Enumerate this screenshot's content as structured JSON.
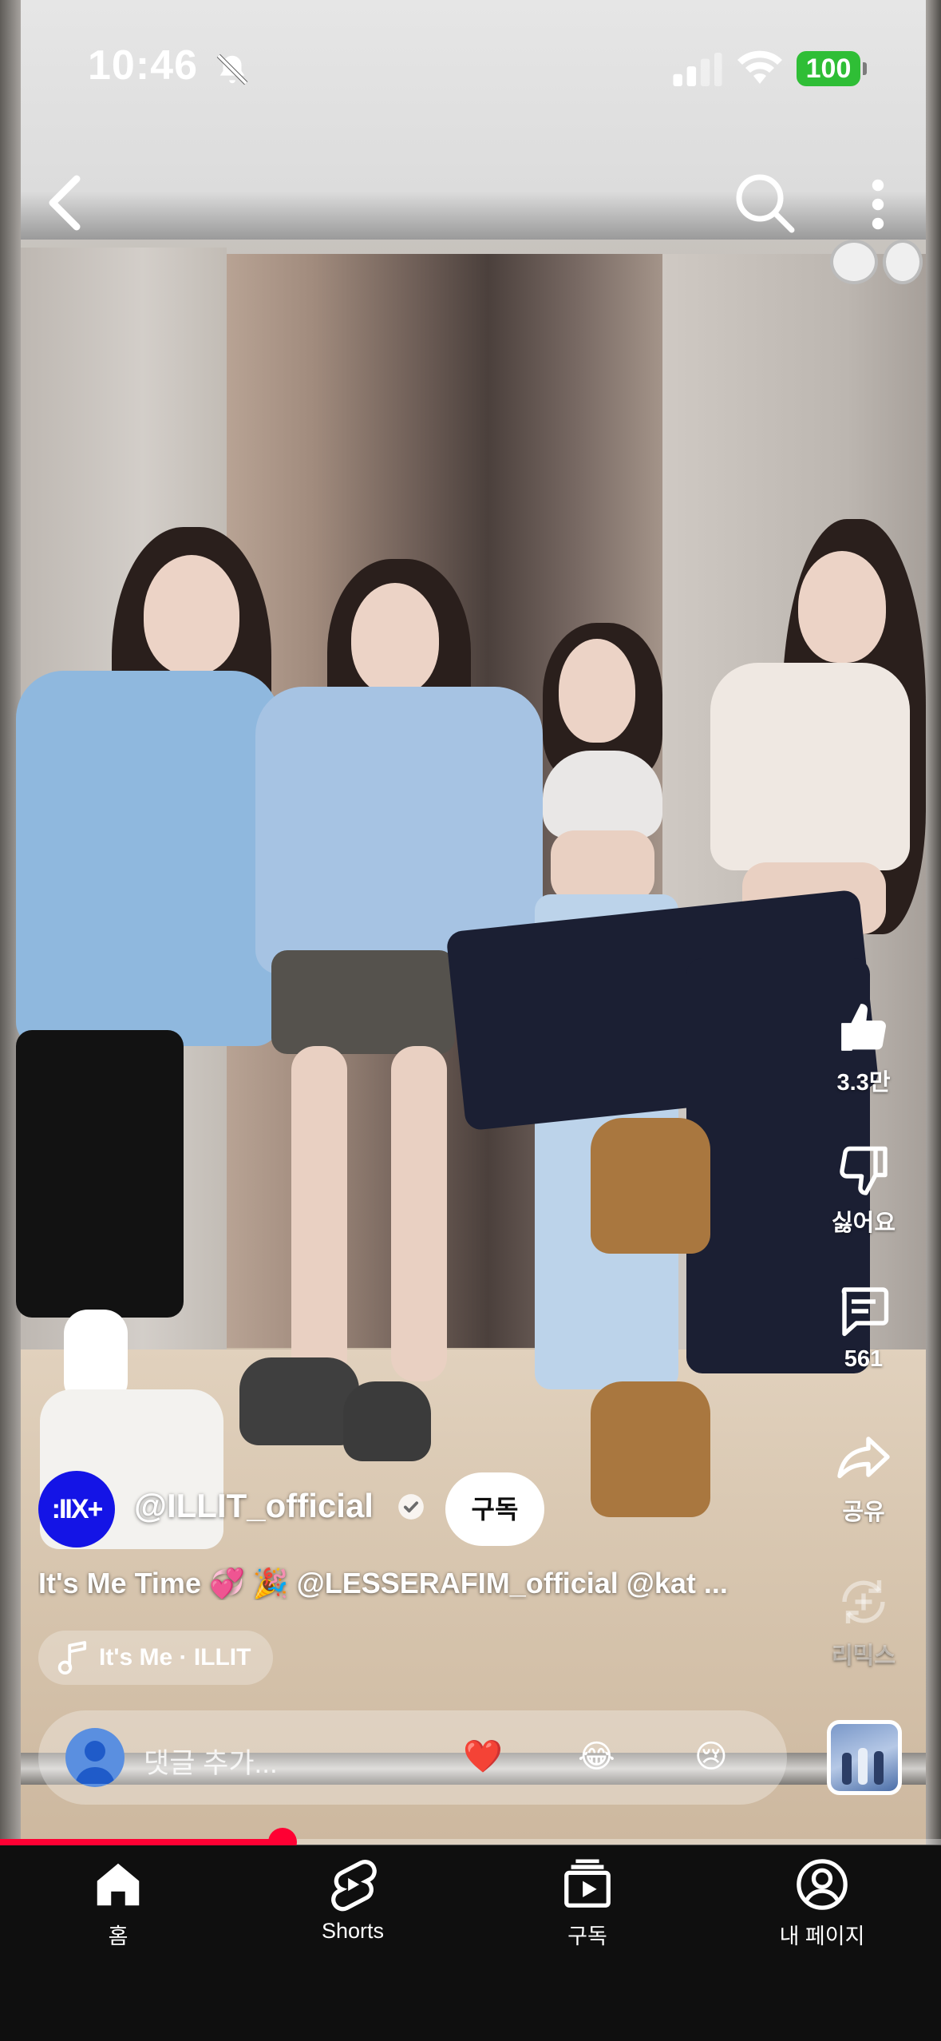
{
  "status_bar": {
    "time": "10:46",
    "battery": "100"
  },
  "toolbar": {
    "back_icon": "chevron-left-icon",
    "search_icon": "search-icon",
    "more_icon": "more-vertical-icon"
  },
  "actions": {
    "like_count": "3.3만",
    "dislike_label": "싫어요",
    "comments_count": "561",
    "share_label": "공유",
    "remix_label": "리믹스"
  },
  "channel": {
    "avatar_text": ":IIX+",
    "name": "@ILLIT_official",
    "subscribe_label": "구독"
  },
  "caption": "It's Me Time 💞 🎉 @LESSERAFIM_official  @kat ...",
  "music": {
    "label": "It's Me · ILLIT"
  },
  "comment_bar": {
    "placeholder": "댓글 추가...",
    "emojis": [
      "❤️",
      "😂",
      "😢"
    ]
  },
  "progress": {
    "fraction": 0.3
  },
  "bottom_nav": {
    "items": [
      {
        "label": "홈",
        "icon": "home-icon"
      },
      {
        "label": "Shorts",
        "icon": "shorts-icon"
      },
      {
        "label": "구독",
        "icon": "subscriptions-icon"
      },
      {
        "label": "내 페이지",
        "icon": "profile-icon"
      }
    ]
  },
  "colors": {
    "accent": "#ff0033",
    "channel_avatar": "#1414e6",
    "battery": "#2fbe36",
    "nav_bg": "#0f0f0f"
  }
}
